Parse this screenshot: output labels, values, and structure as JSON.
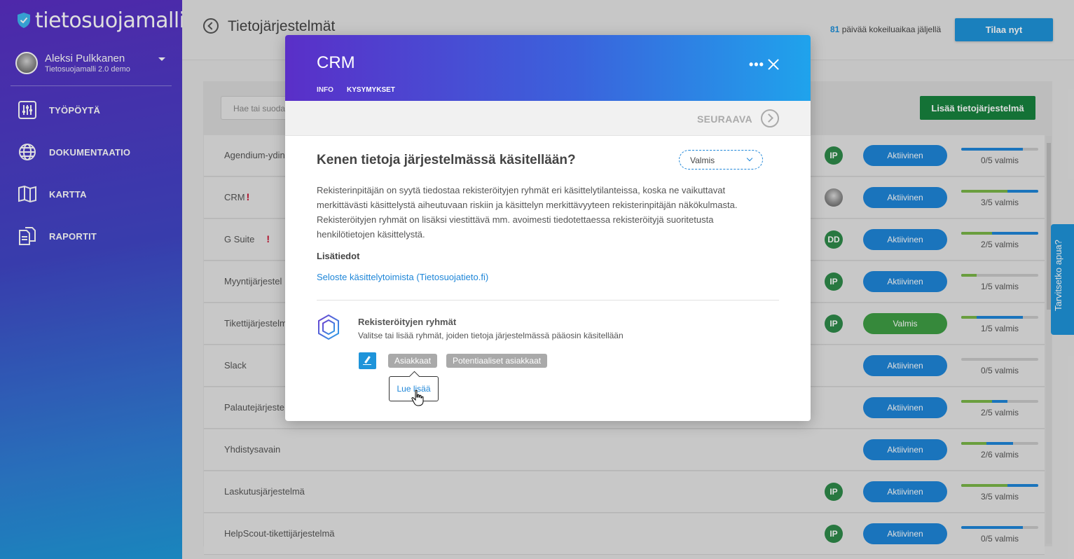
{
  "app": {
    "logo": "tietosuojamalli",
    "user_name": "Aleksi Pulkkanen",
    "user_org": "Tietosuojamalli 2.0 demo"
  },
  "nav": {
    "items": [
      {
        "label": "TYÖPÖYTÄ",
        "icon": "sliders-icon"
      },
      {
        "label": "DOKUMENTAATIO",
        "icon": "globe-icon"
      },
      {
        "label": "KARTTA",
        "icon": "map-icon"
      },
      {
        "label": "RAPORTIT",
        "icon": "documents-icon"
      }
    ]
  },
  "header": {
    "title": "Tietojärjestelmät",
    "trial_days": "81",
    "trial_text": " päivää kokeiluaikaa jäljellä",
    "order_label": "Tilaa nyt"
  },
  "list": {
    "search_placeholder": "Hae tai suoda",
    "add_label": "Lisää tietojärjestelmä",
    "rows": [
      {
        "name": "Agendium-ydin",
        "warn": "",
        "owner": "IP",
        "status": "Aktiivinen",
        "done": 0.0,
        "progress": 0.8,
        "label": "0/5 valmis"
      },
      {
        "name": "CRM",
        "warn": "!",
        "owner": "",
        "status": "Aktiivinen",
        "done": 0.6,
        "progress": 1.0,
        "label": "3/5 valmis"
      },
      {
        "name": "G Suite",
        "warn": "!",
        "owner": "DD",
        "status": "Aktiivinen",
        "done": 0.4,
        "progress": 1.0,
        "label": "2/5 valmis"
      },
      {
        "name": "Myyntijärjestel",
        "warn": "",
        "owner": "IP",
        "status": "Aktiivinen",
        "done": 0.2,
        "progress": 0.2,
        "label": "1/5 valmis"
      },
      {
        "name": "Tikettijärjestelm",
        "warn": "",
        "owner": "IP",
        "status": "Valmis",
        "done": 0.2,
        "progress": 0.8,
        "label": "1/5 valmis"
      },
      {
        "name": "Slack",
        "warn": "",
        "owner": "",
        "status": "Aktiivinen",
        "done": 0.0,
        "progress": 0.0,
        "label": "0/5 valmis"
      },
      {
        "name": "Palautejärjeste",
        "warn": "",
        "owner": "",
        "status": "Aktiivinen",
        "done": 0.4,
        "progress": 0.6,
        "label": "2/5 valmis"
      },
      {
        "name": "Yhdistysavain",
        "warn": "",
        "owner": "",
        "status": "Aktiivinen",
        "done": 0.33,
        "progress": 0.67,
        "label": "2/6 valmis"
      },
      {
        "name": "Laskutusjärjestelmä",
        "warn": "",
        "owner": "IP",
        "status": "Aktiivinen",
        "done": 0.6,
        "progress": 1.0,
        "label": "3/5 valmis"
      },
      {
        "name": "HelpScout-tikettijärjestelmä",
        "warn": "",
        "owner": "IP",
        "status": "Aktiivinen",
        "done": 0.0,
        "progress": 0.8,
        "label": "0/5 valmis"
      }
    ]
  },
  "help": {
    "label": "Tarvitsetko apua?"
  },
  "modal": {
    "title": "CRM",
    "more": "•••",
    "tab_info": "INFO",
    "tab_questions": "KYSYMYKSET",
    "next_label": "SEURAAVA",
    "question": "Kenen tietoja järjestelmässä käsitellään?",
    "state": "Valmis",
    "description": "Rekisterinpitäjän on syytä tiedostaa rekisteröityjen ryhmät eri käsittelytilanteissa, koska ne vaikuttavat merkittävästi käsittelystä aiheutuvaan riskiin ja käsittelyn merkittävyyteen rekisterinpitäjän näkökulmasta. Rekisteröityjen ryhmät on lisäksi viestittävä mm. avoimesti tiedotettaessa rekisteröityjä suoritetusta henkilötietojen käsittelystä.",
    "more_title": "Lisätiedot",
    "more_link": "Seloste käsittelytoimista (Tietosuojatieto.fi)",
    "group_title": "Rekisteröityjen ryhmät",
    "group_sub": "Valitse tai lisää ryhmät, joiden tietoja järjestelmässä pääosin käsitellään",
    "chips": [
      "Asiakkaat",
      "Potentiaaliset asiakkaat"
    ],
    "tooltip": "Lue lisää"
  },
  "colors": {
    "accent": "#1e94da",
    "success": "#17833f",
    "status_done": "#3e9e44",
    "progress_done": "#7ab648",
    "warn": "#c8102e"
  }
}
